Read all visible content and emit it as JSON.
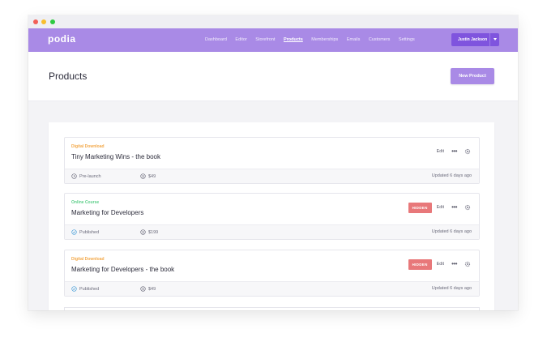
{
  "app": {
    "logo": "podia"
  },
  "nav": {
    "items": [
      "Dashboard",
      "Editor",
      "Storefront",
      "Products",
      "Memberships",
      "Emails",
      "Customers",
      "Settings"
    ],
    "active": "Products",
    "user": "Justin Jackson"
  },
  "header": {
    "title": "Products",
    "new_product_label": "New Product"
  },
  "colors": {
    "brand": "#a98ae6",
    "digital_download": "#f3a94a",
    "online_course": "#5fcf8b",
    "hidden_badge": "#e8787a"
  },
  "products": [
    {
      "type": "Digital Download",
      "title": "Tiny Marketing Wins - the book",
      "hidden": false,
      "badge": "",
      "status": "Pre-launch",
      "status_icon": "clock-icon",
      "price": "$49",
      "updated": "Updated 6 days ago",
      "edit": "Edit"
    },
    {
      "type": "Online Course",
      "title": "Marketing for Developers",
      "hidden": true,
      "badge": "HIDDEN",
      "status": "Published",
      "status_icon": "check-circle-icon",
      "price": "$199",
      "updated": "Updated 6 days ago",
      "edit": "Edit"
    },
    {
      "type": "Digital Download",
      "title": "Marketing for Developers - the book",
      "hidden": true,
      "badge": "HIDDEN",
      "status": "Published",
      "status_icon": "check-circle-icon",
      "price": "$49",
      "updated": "Updated 6 days ago",
      "edit": "Edit"
    }
  ]
}
